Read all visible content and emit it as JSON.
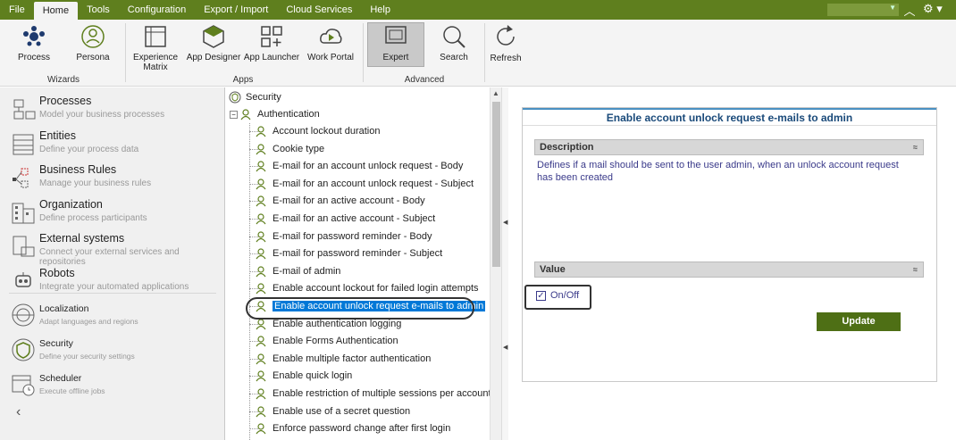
{
  "menu": {
    "tabs": [
      "File",
      "Home",
      "Tools",
      "Configuration",
      "Export / Import",
      "Cloud Services",
      "Help"
    ],
    "active": "Home"
  },
  "ribbon": {
    "buttons": {
      "process": "Process",
      "persona": "Persona",
      "experience": "Experience\nMatrix",
      "appdesigner": "App Designer",
      "applauncher": "App Launcher",
      "workportal": "Work Portal",
      "expert": "Expert",
      "search": "Search",
      "refresh": "Refresh"
    },
    "groups": {
      "wizards": "Wizards",
      "apps": "Apps",
      "advanced": "Advanced"
    }
  },
  "nav": [
    {
      "title": "Processes",
      "sub": "Model your business processes"
    },
    {
      "title": "Entities",
      "sub": "Define your process data"
    },
    {
      "title": "Business Rules",
      "sub": "Manage your business rules"
    },
    {
      "title": "Organization",
      "sub": "Define process participants"
    },
    {
      "title": "External systems",
      "sub": "Connect your external services and repositories"
    },
    {
      "title": "Robots",
      "sub": "Integrate your automated applications"
    },
    {
      "title": "Localization",
      "sub": "Adapt languages and regions"
    },
    {
      "title": "Security",
      "sub": "Define your security settings"
    },
    {
      "title": "Scheduler",
      "sub": "Execute offline jobs"
    }
  ],
  "tree": {
    "root": "Security",
    "group": "Authentication",
    "items": [
      "Account lockout duration",
      "Cookie type",
      "E-mail for an account unlock request - Body",
      "E-mail for an account unlock request - Subject",
      "E-mail for an active account - Body",
      "E-mail for an active account - Subject",
      "E-mail for password reminder - Body",
      "E-mail for password reminder - Subject",
      "E-mail of admin",
      "Enable account lockout for failed login attempts",
      "Enable account unlock request e-mails to admin",
      "Enable authentication logging",
      "Enable Forms Authentication",
      "Enable multiple factor authentication",
      "Enable quick login",
      "Enable restriction of multiple sessions per account",
      "Enable use of a secret question",
      "Enforce password change after first login"
    ],
    "selected_index": 10
  },
  "detail": {
    "title": "Enable account unlock request e-mails to admin",
    "desc_label": "Description",
    "description": "Defines if a mail should be sent to the user admin, when an unlock account request has been created",
    "value_label": "Value",
    "checkbox_label": "On/Off",
    "checked": true,
    "update_label": "Update"
  },
  "colors": {
    "brand": "#5f7f1e",
    "selection": "#0078d7",
    "title": "#1a4a7a"
  }
}
